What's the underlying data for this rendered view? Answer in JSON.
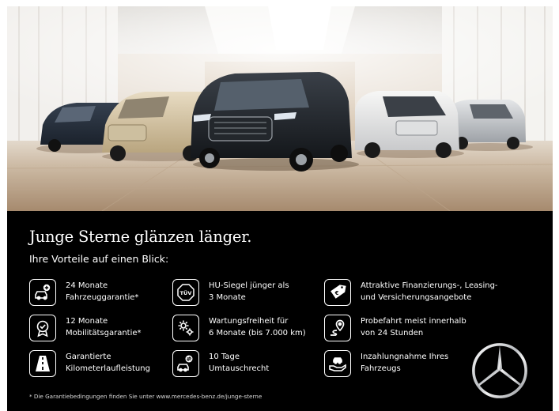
{
  "hero": {
    "description_icon": "vans-showroom-photo"
  },
  "headline": "Junge Sterne glänzen länger.",
  "subheadline": "Ihre Vorteile auf einen Blick:",
  "benefits": [
    {
      "icon": "car-plus-icon",
      "line1": "24 Monate",
      "line2": "Fahrzeuggarantie*"
    },
    {
      "icon": "tuv-badge-icon",
      "line1": "HU-Siegel jünger als",
      "line2": "3 Monate"
    },
    {
      "icon": "euro-tag-icon",
      "line1": "Attraktive Finanzierungs-, Leasing-",
      "line2": "und Versicherungsangebote"
    },
    {
      "icon": "mobility-badge-icon",
      "line1": "12 Monate",
      "line2": "Mobilitätsgarantie*"
    },
    {
      "icon": "service-gears-icon",
      "line1": "Wartungsfreiheit für",
      "line2": "6 Monate (bis 7.000 km)"
    },
    {
      "icon": "route-pin-icon",
      "line1": "Probefahrt meist innerhalb",
      "line2": "von 24 Stunden"
    },
    {
      "icon": "road-icon",
      "line1": "Garantierte",
      "line2": "Kilometerlaufleistung"
    },
    {
      "icon": "car-exchange-icon",
      "line1": "10 Tage",
      "line2": "Umtauschrecht"
    },
    {
      "icon": "hand-car-icon",
      "line1": "Inzahlungnahme Ihres",
      "line2": "Fahrzeugs"
    }
  ],
  "footnote": "* Die Garantiebedingungen finden Sie unter www.mercedes-benz.de/junge-sterne",
  "colors": {
    "panel": "#000000",
    "text": "#ffffff",
    "floor": "#b59f86"
  }
}
